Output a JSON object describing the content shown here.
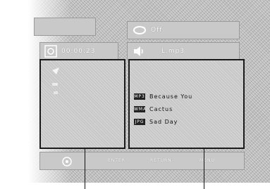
{
  "header": {
    "repeat_label": "Off",
    "elapsed_time": "00:00:23",
    "filename": "L.mp3"
  },
  "tracks": [
    {
      "badge": "MP3",
      "title": "Because You"
    },
    {
      "badge": "WMA",
      "title": "Cactus"
    },
    {
      "badge": "JPG",
      "title": "Sad Day"
    }
  ],
  "footer": {
    "enter_label": "ENTER",
    "return_label": "RETURN",
    "menu_label": "MENU"
  },
  "icons": {
    "repeat": "loop-icon",
    "disc": "disc-icon",
    "speaker": "speaker-icon",
    "navigate": "navigate-icon"
  }
}
